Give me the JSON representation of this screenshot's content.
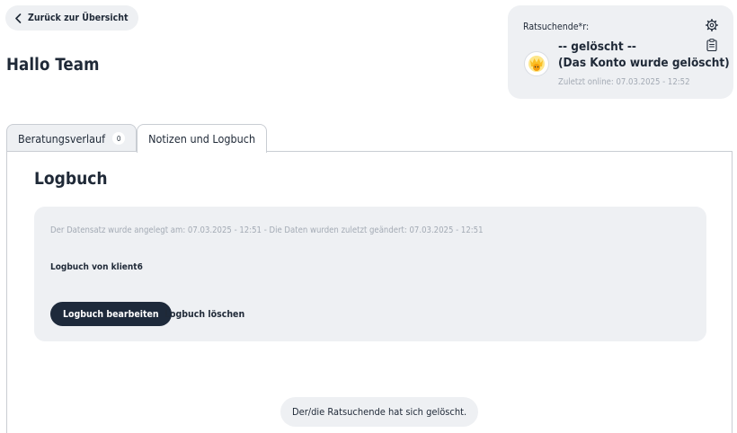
{
  "header": {
    "back_label": "Zurück zur Übersicht",
    "greeting": "Hallo Team"
  },
  "client_card": {
    "label": "Ratsuchende*r:",
    "name_line1": "-- gelöscht --",
    "name_line2": "(Das Konto wurde gelöscht)",
    "last_online": "Zuletzt online: 07.03.2025 - 12:52",
    "icons": [
      "gear-icon",
      "clipboard-icon",
      "avatar-icon"
    ]
  },
  "tabs": [
    {
      "label": "Beratungsverlauf",
      "count": "0",
      "active": false
    },
    {
      "label": "Notizen und Logbuch",
      "active": true
    }
  ],
  "logbook": {
    "title": "Logbuch",
    "meta": "Der Datensatz wurde angelegt am: 07.03.2025 - 12:51 - Die Daten wurden zuletzt geändert: 07.03.2025 - 12:51",
    "owner": "Logbuch von klient6",
    "edit_label": "Logbuch bearbeiten",
    "delete_label": "Logbuch löschen"
  },
  "status_message": "Der/die Ratsuchende hat sich gelöscht.",
  "colors": {
    "accent_dark": "#1e2a3b",
    "card_bg": "#eef0f3",
    "muted_text": "#a3aab4"
  }
}
